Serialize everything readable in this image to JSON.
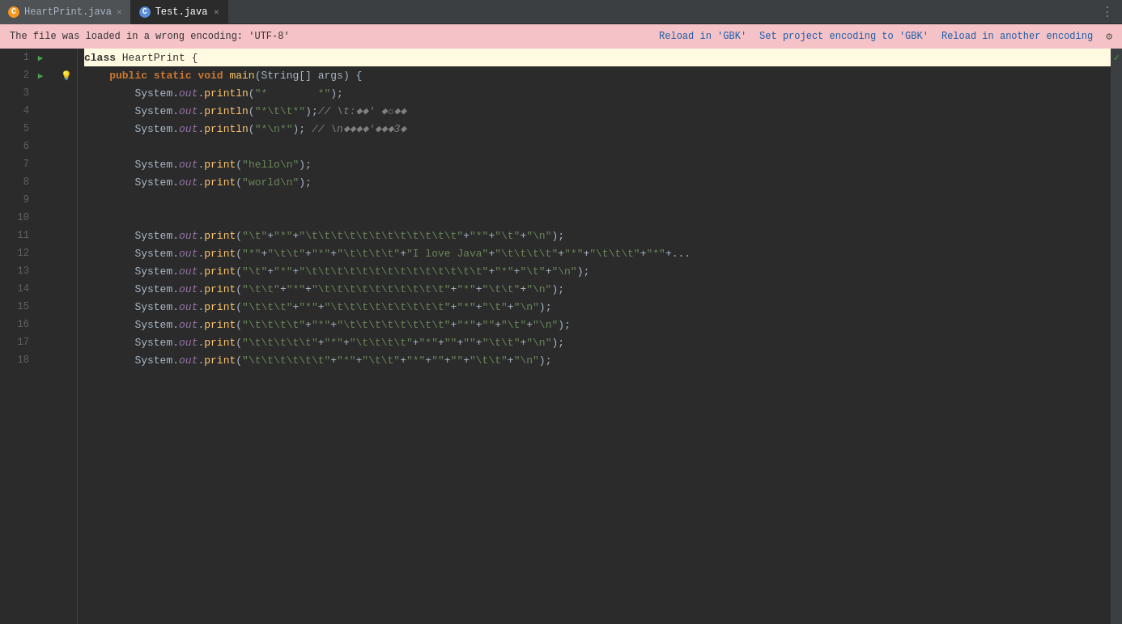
{
  "tabs": [
    {
      "id": "heartprint",
      "label": "HeartPrint.java",
      "icon": "java",
      "active": false,
      "closable": true
    },
    {
      "id": "test",
      "label": "Test.java",
      "icon": "c",
      "active": true,
      "closable": true
    }
  ],
  "notification": {
    "text": "The file was loaded in a wrong encoding: 'UTF-8'",
    "actions": [
      {
        "id": "reload-gbk",
        "label": "Reload in 'GBK'"
      },
      {
        "id": "set-project-gbk",
        "label": "Set project encoding to 'GBK'"
      },
      {
        "id": "reload-another",
        "label": "Reload in another encoding"
      }
    ]
  },
  "code_lines": [
    {
      "num": 1,
      "run": true,
      "hint": false,
      "bp": false,
      "highlighted": true,
      "content": "class HeartPrint {"
    },
    {
      "num": 2,
      "run": true,
      "hint": true,
      "bp": false,
      "highlighted": false,
      "content": "    public static void main(String[] args) {"
    },
    {
      "num": 3,
      "run": false,
      "hint": false,
      "bp": false,
      "highlighted": false,
      "content": "        System.out.println(\"*        *\");"
    },
    {
      "num": 4,
      "run": false,
      "hint": false,
      "bp": false,
      "highlighted": false,
      "content": "        System.out.println(\"*\\t\\t*\");// \\t:??' ?????"
    },
    {
      "num": 5,
      "run": false,
      "hint": false,
      "bp": false,
      "highlighted": false,
      "content": "        System.out.println(\"*\\n*\"); // \\n????'???3?"
    },
    {
      "num": 6,
      "run": false,
      "hint": false,
      "bp": false,
      "highlighted": false,
      "content": ""
    },
    {
      "num": 7,
      "run": false,
      "hint": false,
      "bp": false,
      "highlighted": false,
      "content": "        System.out.print(\"hello\\n\");"
    },
    {
      "num": 8,
      "run": false,
      "hint": false,
      "bp": false,
      "highlighted": false,
      "content": "        System.out.print(\"world\\n\");"
    },
    {
      "num": 9,
      "run": false,
      "hint": false,
      "bp": false,
      "highlighted": false,
      "content": ""
    },
    {
      "num": 10,
      "run": false,
      "hint": false,
      "bp": false,
      "highlighted": false,
      "content": ""
    },
    {
      "num": 11,
      "run": false,
      "hint": false,
      "bp": false,
      "highlighted": false,
      "content": "        System.out.print(\"\\t\"+\"*\"+\"\\t\\t\\t\\t\\t\\t\\t\\t\\t\\t\\t\\t\"+ \"*\"+\"\\t\"+\"\\n\");"
    },
    {
      "num": 12,
      "run": false,
      "hint": false,
      "bp": false,
      "highlighted": false,
      "content": "        System.out.print(\"*\"+\"\\t\\t\"+\"*\"+\"\\t\\t\\t\\t\"+\"I love Java\"+\"\\t\\t\\t\\t\"+\"*\"+\"\\t\\t\\t\"+\"*\"+..."
    },
    {
      "num": 13,
      "run": false,
      "hint": false,
      "bp": false,
      "highlighted": false,
      "content": "        System.out.print(\"\\t\"+\"*\"+\"\\t\\t\\t\\t\\t\\t\\t\\t\\t\\t\\t\\t\\t\\t\"+\"*\"+\"\\t\"+\"\\n\");"
    },
    {
      "num": 14,
      "run": false,
      "hint": false,
      "bp": false,
      "highlighted": false,
      "content": "        System.out.print(\"\\t\\t\"+\"*\"+\"\\t\\t\\t\\t\\t\\t\\t\\t\\t\\t\"+\"*\"+\"\\t\\t\"+\"\\n\");"
    },
    {
      "num": 15,
      "run": false,
      "hint": false,
      "bp": false,
      "highlighted": false,
      "content": "        System.out.print(\"\\t\\t\\t\"+\"*\"+\"\\t\\t\\t\\t\\t\\t\\t\\t\\t\"+\"*\"+\"\\t\"+\"\\n\");"
    },
    {
      "num": 16,
      "run": false,
      "hint": false,
      "bp": false,
      "highlighted": false,
      "content": "        System.out.print(\"\\t\\t\\t\\t\"+\"*\"+\"\\t\\t\\t\\t\\t\\t\\t\\t\"+\"*\"+\"\"+\"\\t\"+\"\\n\");"
    },
    {
      "num": 17,
      "run": false,
      "hint": false,
      "bp": false,
      "highlighted": false,
      "content": "        System.out.print(\"\\t\\t\\t\\t\\t\"+\"*\"+\"\\t\\t\\t\\t\"+\"*\"+\"\"+\"\"+\"\\t\\t\"+\"\\n\");"
    },
    {
      "num": 18,
      "run": false,
      "hint": false,
      "bp": false,
      "highlighted": false,
      "content": "        System.out.print(\"\\t\\t\\t\\t\\t\\t\"+\"*\"+\"\\t\\t\"+\"*\"+\"\"+\"\"+\"\\t\\t\"+\"\\n\");"
    }
  ],
  "more_icon": "⋮",
  "check_icon": "✓",
  "run_icon": "▶",
  "hint_icon": "💡",
  "gear_icon": "⚙"
}
